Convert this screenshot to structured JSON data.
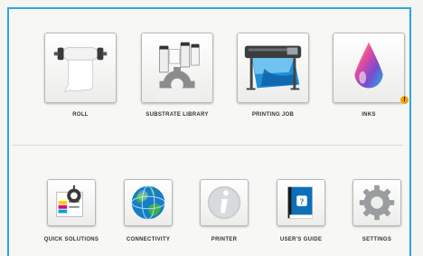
{
  "top_row": [
    {
      "id": "roll",
      "label": "ROLL",
      "icon": "paper-roll-icon"
    },
    {
      "id": "substrate-library",
      "label": "SUBSTRATE LIBRARY",
      "icon": "substrate-library-icon"
    },
    {
      "id": "printing-job",
      "label": "PRINTING JOB",
      "icon": "large-format-printer-icon"
    },
    {
      "id": "inks",
      "label": "INKS",
      "icon": "ink-drop-icon",
      "warning": "!"
    }
  ],
  "bottom_row": [
    {
      "id": "quick-solutions",
      "label": "QUICK SOLUTIONS",
      "icon": "quick-solutions-icon"
    },
    {
      "id": "connectivity",
      "label": "CONNECTIVITY",
      "icon": "globe-icon"
    },
    {
      "id": "printer",
      "label": "PRINTER",
      "icon": "info-icon"
    },
    {
      "id": "users-guide",
      "label": "USER'S GUIDE",
      "icon": "book-icon"
    },
    {
      "id": "settings",
      "label": "SETTINGS",
      "icon": "gear-icon"
    }
  ],
  "colors": {
    "frame": "#27a8e0",
    "warning": "#f0a20a"
  }
}
